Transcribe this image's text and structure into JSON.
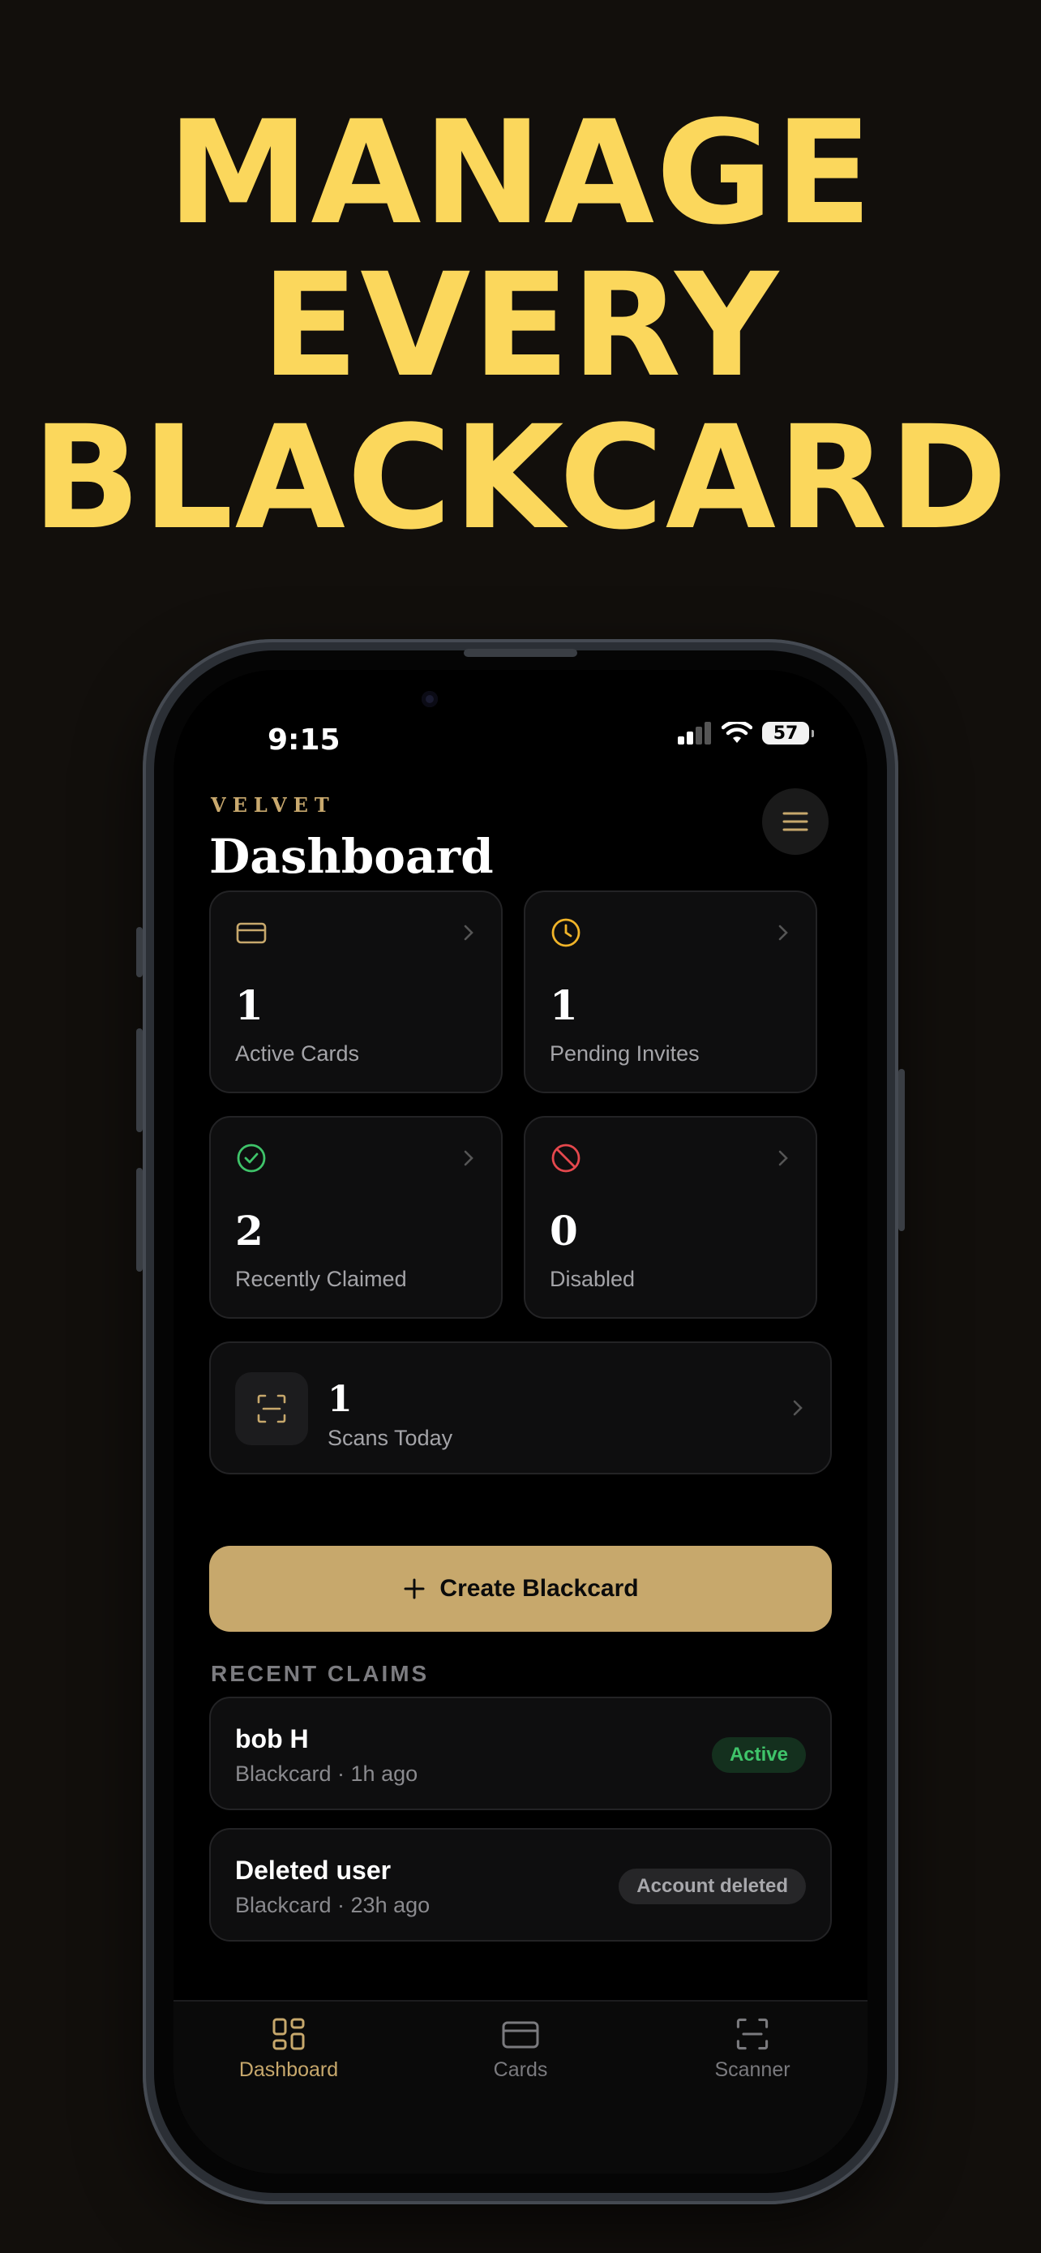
{
  "headline": [
    "MANAGE",
    "EVERY",
    "BLACKCARD"
  ],
  "status_bar": {
    "time": "9:15",
    "battery": "57"
  },
  "header": {
    "brand": "VELVET",
    "title": "Dashboard"
  },
  "stats": [
    {
      "value": "1",
      "label": "Active Cards",
      "icon": "card-icon"
    },
    {
      "value": "1",
      "label": "Pending Invites",
      "icon": "clock-icon"
    },
    {
      "value": "2",
      "label": "Recently Claimed",
      "icon": "check-circle-icon"
    },
    {
      "value": "0",
      "label": "Disabled",
      "icon": "ban-icon"
    }
  ],
  "scans": {
    "value": "1",
    "label": "Scans Today",
    "icon": "scan-icon"
  },
  "create_button": {
    "label": "Create Blackcard",
    "icon": "plus-icon"
  },
  "recent_claims": {
    "heading": "RECENT CLAIMS",
    "items": [
      {
        "name": "bob H",
        "subtitle": "Blackcard · 1h ago",
        "status": "Active"
      },
      {
        "name": "Deleted user",
        "subtitle": "Blackcard · 23h ago",
        "status": "Account deleted"
      }
    ]
  },
  "tabs": [
    {
      "label": "Dashboard",
      "icon": "grid-icon",
      "active": true
    },
    {
      "label": "Cards",
      "icon": "card-icon",
      "active": false
    },
    {
      "label": "Scanner",
      "icon": "scan-icon",
      "active": false
    }
  ],
  "colors": {
    "background": "#120f0c",
    "headline": "#fbd75c",
    "accent_gold": "#c7a86c",
    "active_green": "#3fc46a",
    "disabled_red": "#e5484d",
    "pending_amber": "#f0b429"
  }
}
